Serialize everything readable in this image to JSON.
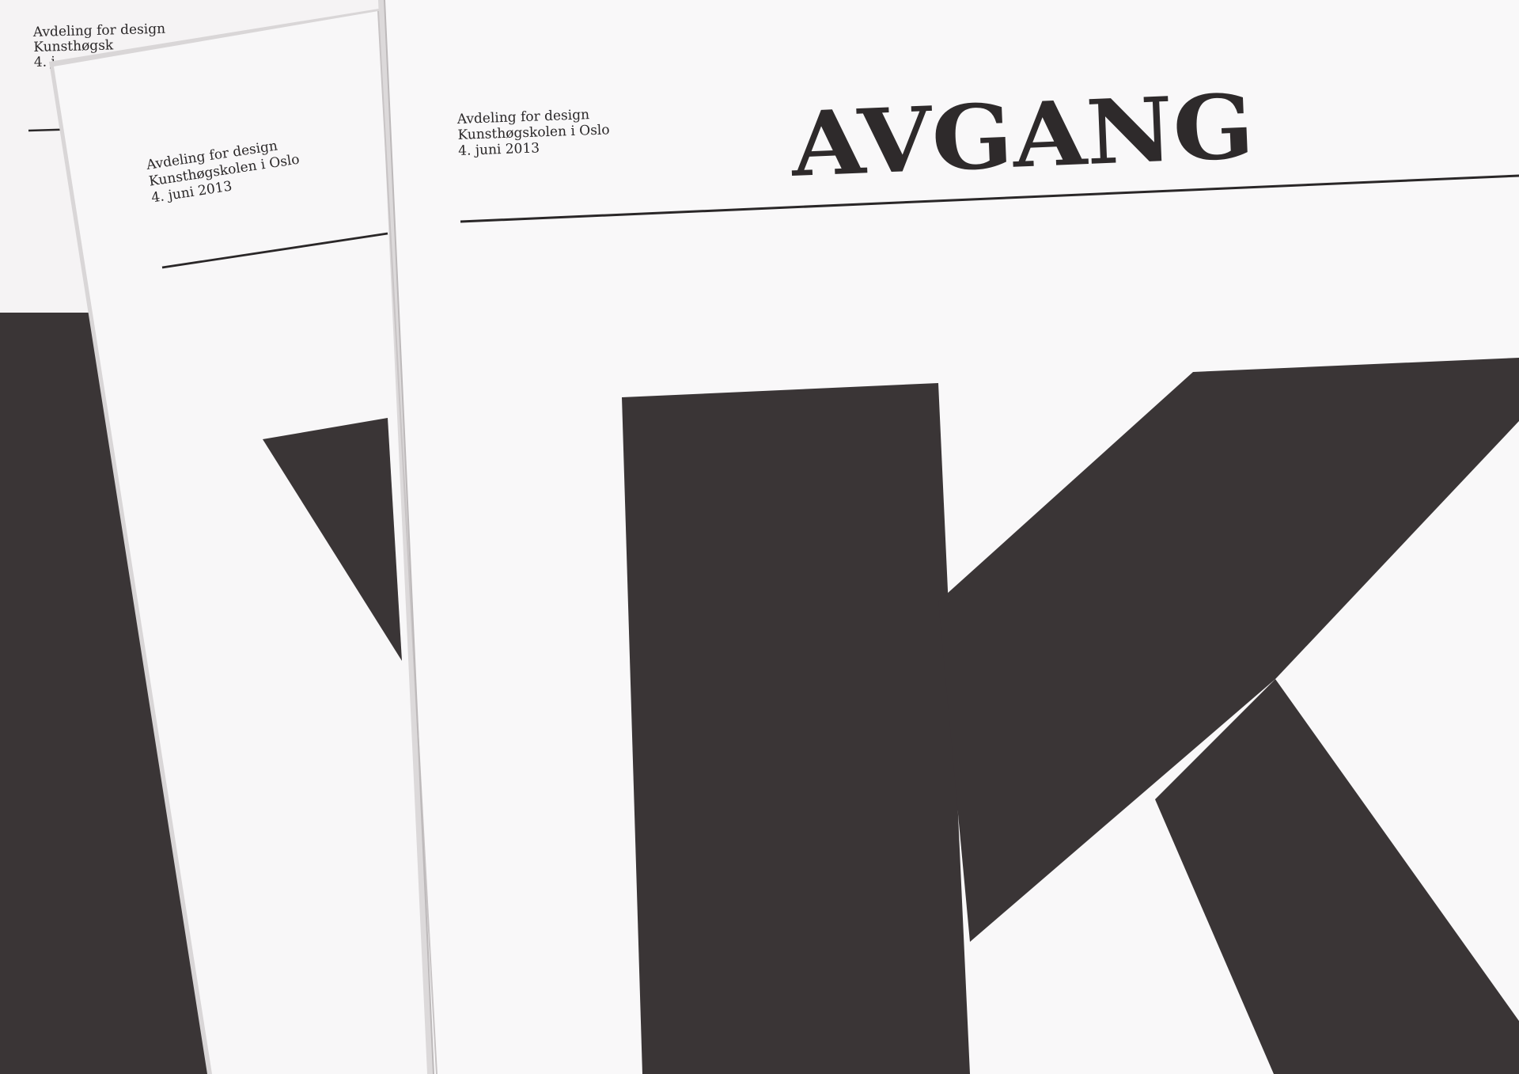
{
  "scene": {
    "description_kind": "photo",
    "colors": {
      "paper": "#f7f5f6",
      "paper_shadow": "#eceaeb",
      "ink": "#2a2728",
      "large_letter_ink": "#3a3536"
    }
  },
  "back_paper": {
    "imprint": {
      "line1": "Avdeling for design",
      "line2": "Kunsthøgsk",
      "line3": "4. j"
    }
  },
  "middle_paper": {
    "imprint": {
      "line1": "Avdeling for design",
      "line2": "Kunsthøgskolen i Oslo",
      "line3": "4. juni 2013"
    }
  },
  "front_paper": {
    "imprint": {
      "line1": "Avdeling for design",
      "line2": "Kunsthøgskolen i Oslo",
      "line3": "4. juni 2013"
    },
    "masthead": "AVGANG",
    "large_letter": "K"
  }
}
